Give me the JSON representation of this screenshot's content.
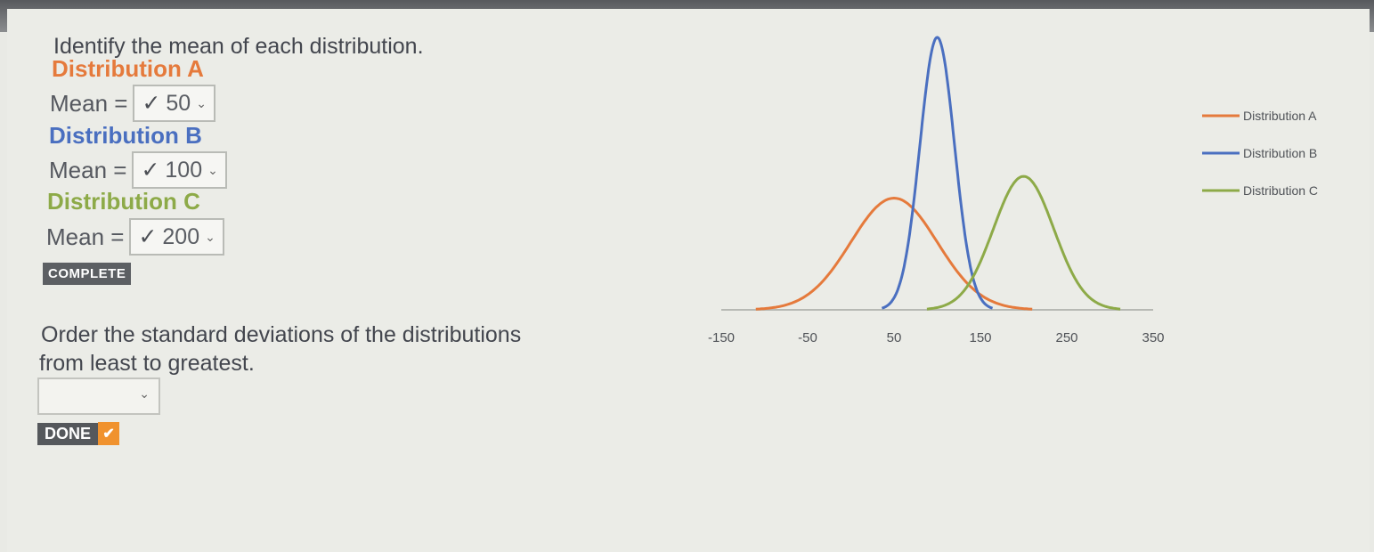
{
  "question1": "Identify the mean of each distribution.",
  "distributions": [
    {
      "title": "Distribution A",
      "mean_label": "Mean =",
      "check": "✓",
      "selected": "50",
      "color": "#e57a3c"
    },
    {
      "title": "Distribution B",
      "mean_label": "Mean =",
      "check": "✓",
      "selected": "100",
      "color": "#4a6fc0"
    },
    {
      "title": "Distribution C",
      "mean_label": "Mean =",
      "check": "✓",
      "selected": "200",
      "color": "#8daa48"
    }
  ],
  "complete_badge": "COMPLETE",
  "question2_line1": "Order the standard deviations of the distributions",
  "question2_line2": "from least to greatest.",
  "order_select": {
    "selected": ""
  },
  "done_button": {
    "label": "DONE",
    "icon": "check-icon"
  },
  "chart_data": {
    "type": "line",
    "x_ticks": [
      "-150",
      "-50",
      "50",
      "150",
      "250",
      "350"
    ],
    "xlim": [
      -150,
      350
    ],
    "grid": false,
    "legend_position": "right",
    "series": [
      {
        "name": "Distribution A",
        "mean": 50,
        "sd": 50,
        "peak": 0.41,
        "color": "#e57a3c"
      },
      {
        "name": "Distribution B",
        "mean": 100,
        "sd": 20,
        "peak": 1.0,
        "color": "#4a6fc0"
      },
      {
        "name": "Distribution C",
        "mean": 200,
        "sd": 35,
        "peak": 0.49,
        "color": "#8daa48"
      }
    ]
  }
}
